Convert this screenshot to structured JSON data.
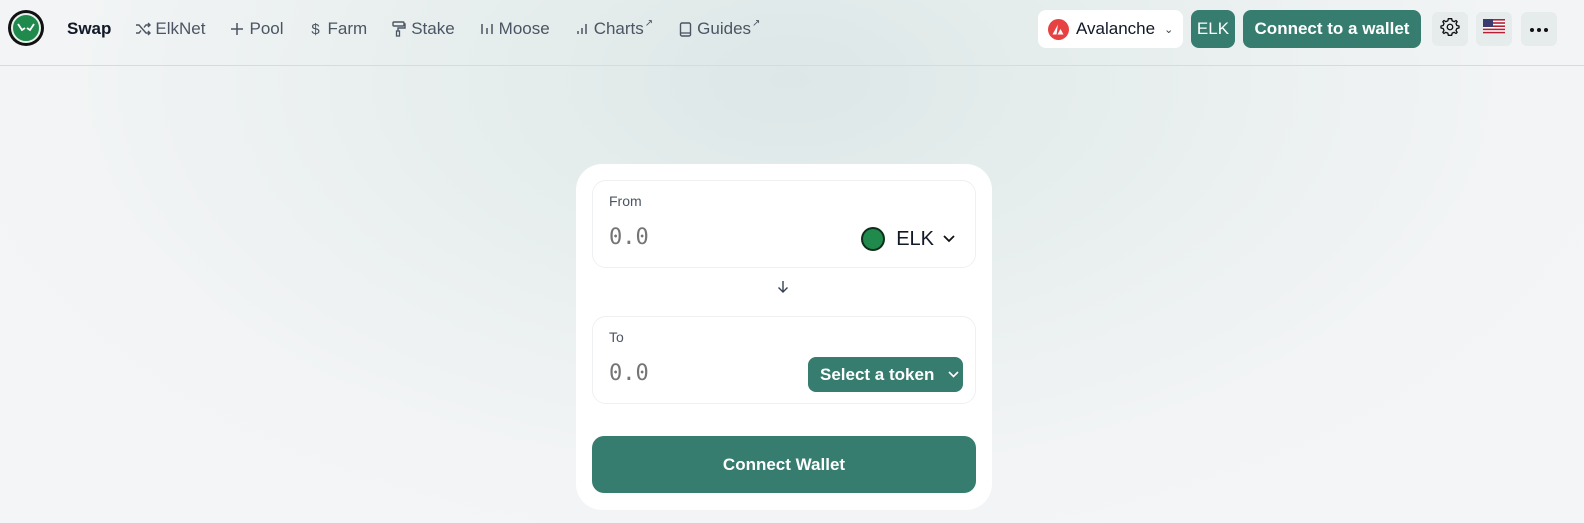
{
  "nav": {
    "items": [
      {
        "label": "Swap",
        "icon": "",
        "external": false,
        "active": true
      },
      {
        "label": "ElkNet",
        "icon": "shuffle-icon",
        "external": false,
        "active": false
      },
      {
        "label": "Pool",
        "icon": "plus-icon",
        "external": false,
        "active": false
      },
      {
        "label": "Farm",
        "icon": "dollar-icon",
        "external": false,
        "active": false
      },
      {
        "label": "Stake",
        "icon": "paint-roller-icon",
        "external": false,
        "active": false
      },
      {
        "label": "Moose",
        "icon": "bars-icon",
        "external": false,
        "active": false
      },
      {
        "label": "Charts",
        "icon": "bar-chart-icon",
        "external": true,
        "active": false
      },
      {
        "label": "Guides",
        "icon": "book-icon",
        "external": true,
        "active": false
      }
    ]
  },
  "header": {
    "chain_label": "Avalanche",
    "elk_label": "ELK",
    "connect_label": "Connect to a wallet"
  },
  "swap": {
    "from_label": "From",
    "from_placeholder": "0.0",
    "from_token": "ELK",
    "to_label": "To",
    "to_placeholder": "0.0",
    "select_token_label": "Select a token",
    "connect_wallet_label": "Connect Wallet"
  },
  "colors": {
    "accent": "#367c6f",
    "avalanche": "#e84142",
    "elk_green": "#1f8a4c"
  }
}
